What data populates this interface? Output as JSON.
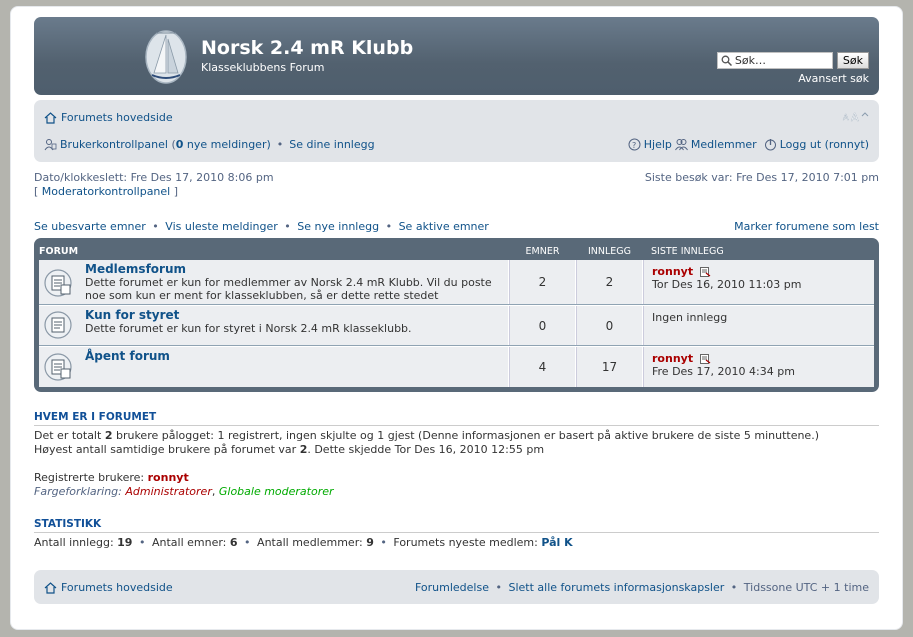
{
  "header": {
    "title": "Norsk 2.4 mR Klubb",
    "description": "Klasseklubbens Forum",
    "search_placeholder": "Søk…",
    "search_button": "Søk",
    "advanced_search": "Avansert søk"
  },
  "nav": {
    "home": "Forumets hovedside",
    "ucp": "Brukerkontrollpanel",
    "ucp_open": "(",
    "messages_count": "0",
    "messages_text": "nye meldinger)",
    "own_posts": "Se dine innlegg",
    "help": "Hjelp",
    "members": "Medlemmer",
    "logout": "Logg ut (ronnyt)"
  },
  "dateline": {
    "current": "Dato/klokkeslett: Fre Des 17, 2010 8:06 pm",
    "mcp_open": "[",
    "mcp": "Moderatorkontrollpanel",
    "mcp_close": "]",
    "last_visit": "Siste besøk var: Fre Des 17, 2010 7:01 pm"
  },
  "links": {
    "unanswered": "Se ubesvarte emner",
    "unread": "Vis uleste meldinger",
    "new_posts": "Se nye innlegg",
    "active": "Se aktive emner",
    "mark_read": "Marker forumene som lest"
  },
  "forum_table": {
    "headers": {
      "forum": "FORUM",
      "topics": "EMNER",
      "posts": "INNLEGG",
      "last": "SISTE INNLEGG"
    },
    "rows": [
      {
        "title": "Medlemsforum",
        "desc": "Dette forumet er kun for medlemmer av Norsk 2.4 mR Klubb. Vil du poste noe som kun er ment for klasseklubben, så er dette rette stedet",
        "topics": "2",
        "posts": "2",
        "last_user": "ronnyt",
        "last_time": "Tor Des 16, 2010 11:03 pm"
      },
      {
        "title": "Kun for styret",
        "desc": "Dette forumet er kun for styret i Norsk 2.4 mR klasseklubb.",
        "topics": "0",
        "posts": "0",
        "last_none": "Ingen innlegg"
      },
      {
        "title": "Åpent forum",
        "desc": "",
        "topics": "4",
        "posts": "17",
        "last_user": "ronnyt",
        "last_time": "Fre Des 17, 2010 4:34 pm"
      }
    ]
  },
  "online": {
    "heading": "HVEM ER I FORUMET",
    "line1_a": "Det er totalt",
    "line1_count": "2",
    "line1_b": "brukere pålogget: 1 registrert, ingen skjulte og 1 gjest (Denne informasjonen er basert på aktive brukere de siste 5 minuttene.)",
    "line2_a": "Høyest antall samtidige brukere på forumet var",
    "line2_count": "2",
    "line2_b": ". Dette skjedde Tor Des 16, 2010 12:55 pm",
    "registered_label": "Registrerte brukere:",
    "registered_user": "ronnyt",
    "legend_label": "Fargeforklaring:",
    "legend_admin": "Administratorer",
    "legend_comma": ",",
    "legend_gmod": "Globale moderatorer"
  },
  "stats": {
    "heading": "STATISTIKK",
    "posts_label": "Antall innlegg:",
    "posts": "19",
    "topics_label": "Antall emner:",
    "topics": "6",
    "members_label": "Antall medlemmer:",
    "members": "9",
    "newest_label": "Forumets nyeste medlem:",
    "newest": "Pål K"
  },
  "footer": {
    "home": "Forumets hovedside",
    "team": "Forumledelse",
    "cookies": "Slett alle forumets informasjonskapsler",
    "timezone": "Tidssone UTC + 1 time"
  },
  "colors": {
    "header_bg": "#52616f",
    "link": "#105289",
    "admin": "#aa0000",
    "gmod": "#00aa00"
  },
  "icons": [
    "logo",
    "search-icon",
    "home-icon",
    "font-size-icon",
    "ucp-icon",
    "help-icon",
    "members-icon",
    "logout-icon",
    "forum-read-icon",
    "view-latest-icon"
  ]
}
